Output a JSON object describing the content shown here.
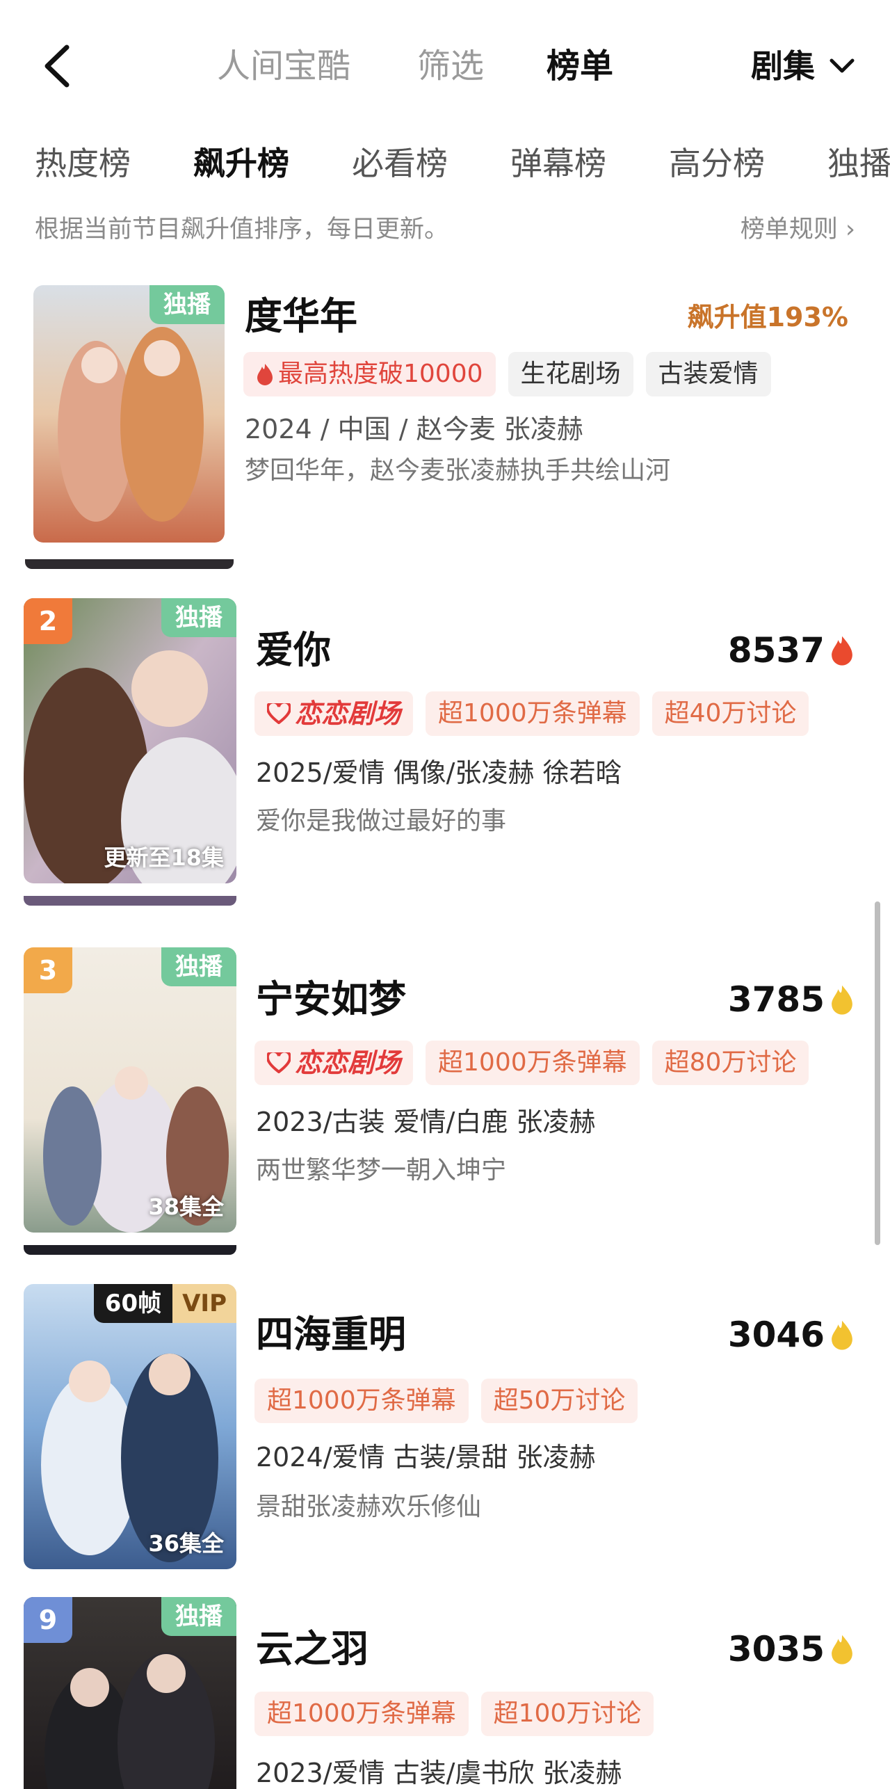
{
  "nav": {
    "tabs": [
      "人间宝酷",
      "筛选",
      "榜单"
    ],
    "active_tab": "榜单",
    "series_label": "剧集"
  },
  "categories": [
    "热度榜",
    "飙升榜",
    "必看榜",
    "弹幕榜",
    "高分榜",
    "独播"
  ],
  "active_category": "飙升榜",
  "description": "根据当前节目飙升值排序，每日更新。",
  "rules_label": "榜单规则",
  "items": [
    {
      "title": "度华年",
      "badge": "独播",
      "score_text": "飙升值193%",
      "tags": [
        "最高热度破10000",
        "生花剧场",
        "古装爱情"
      ],
      "meta": "2024 / 中国 / 赵今麦 张凌赫",
      "desc": "梦回华年，赵今麦张凌赫执手共绘山河"
    },
    {
      "rank": "2",
      "title": "爱你",
      "badge": "独播",
      "score": "8537",
      "poster_foot": "更新至18集",
      "logo_tag": "恋恋剧场",
      "tags": [
        "超1000万条弹幕",
        "超40万讨论"
      ],
      "meta": "2025/爱情 偶像/张凌赫 徐若晗",
      "desc": "爱你是我做过最好的事"
    },
    {
      "rank": "3",
      "title": "宁安如梦",
      "badge": "独播",
      "score": "3785",
      "poster_foot": "38集全",
      "logo_tag": "恋恋剧场",
      "tags": [
        "超1000万条弹幕",
        "超80万讨论"
      ],
      "meta": "2023/古装 爱情/白鹿 张凌赫",
      "desc": "两世繁华梦一朝入坤宁"
    },
    {
      "title": "四海重明",
      "badge_left": "60帧",
      "badge_right": "VIP",
      "score": "3046",
      "poster_foot": "36集全",
      "tags": [
        "超1000万条弹幕",
        "超50万讨论"
      ],
      "meta": "2024/爱情 古装/景甜 张凌赫",
      "desc": "景甜张凌赫欢乐修仙"
    },
    {
      "rank": "9",
      "title": "云之羽",
      "badge": "独播",
      "score": "3035",
      "tags": [
        "超1000万条弹幕",
        "超100万讨论"
      ],
      "meta": "2023/爱情 古装/虞书欣 张凌赫"
    }
  ]
}
